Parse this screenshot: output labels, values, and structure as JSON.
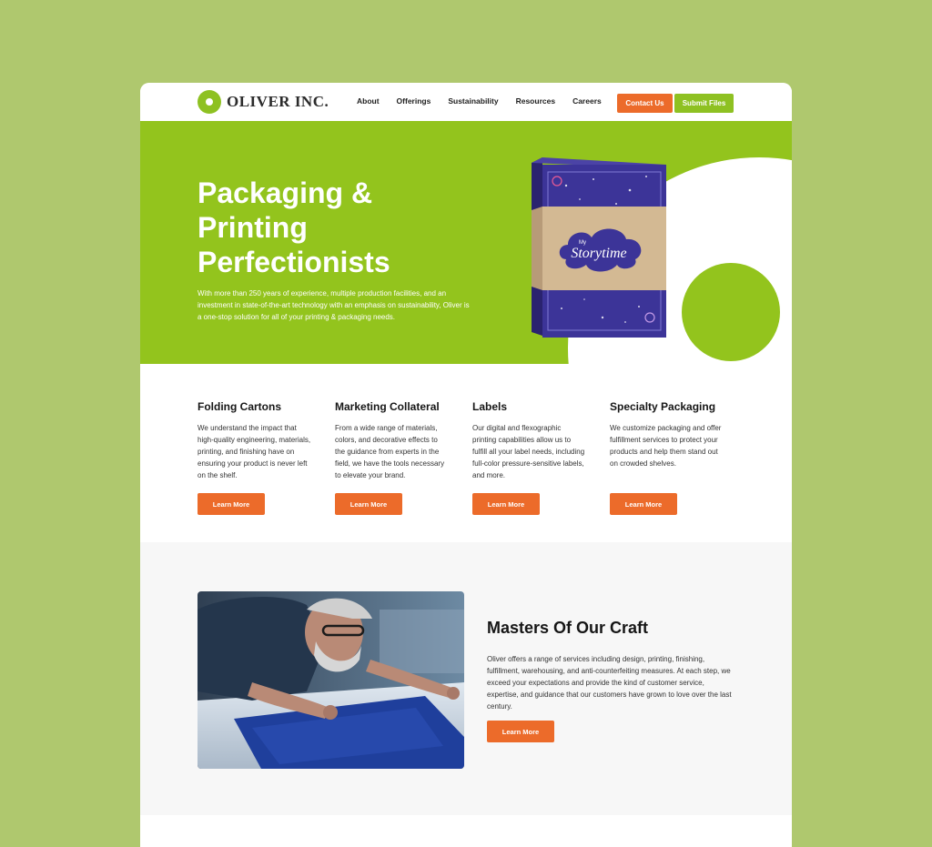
{
  "brand": {
    "name": "OLIVER INC.",
    "green": "#93c41d",
    "orange": "#ec6b2a"
  },
  "nav": {
    "items": [
      "About",
      "Offerings",
      "Sustainability",
      "Resources",
      "Careers"
    ],
    "contact_label": "Contact Us",
    "submit_label": "Submit Files"
  },
  "hero": {
    "title": "Packaging & Printing Perfectionists",
    "text": "With more than 250 years of experience, multiple production facilities, and an investment in state-of-the-art technology with an emphasis on sustainability, Oliver is a one-stop solution for all of your printing & packaging needs.",
    "product_label": "Storytime",
    "product_sublabel": "My"
  },
  "services": [
    {
      "title": "Folding Cartons",
      "text": "We understand the impact that high-quality engineering, materials, printing, and finishing have on ensuring your product is never left on the shelf.",
      "button": "Learn More"
    },
    {
      "title": "Marketing Collateral",
      "text": "From a wide range of materials, colors, and decorative effects to the guidance from experts in the field, we have the tools necessary to elevate your brand.",
      "button": "Learn More"
    },
    {
      "title": "Labels",
      "text": "Our digital and flexographic printing capabilities allow us to fulfill all your label needs, including full-color pressure-sensitive labels, and more.",
      "button": "Learn More"
    },
    {
      "title": "Specialty Packaging",
      "text": "We customize packaging and offer fulfillment services to protect your products and help them stand out on crowded shelves.",
      "button": "Learn More"
    }
  ],
  "masters": {
    "title": "Masters Of Our Craft",
    "text": "Oliver offers a range of services including design, printing, finishing, fulfillment, warehousing, and anti-counterfeiting measures. At each step, we exceed your expectations and provide the kind of customer service, expertise, and guidance that our customers have grown to love over the last century.",
    "button": "Learn More"
  }
}
